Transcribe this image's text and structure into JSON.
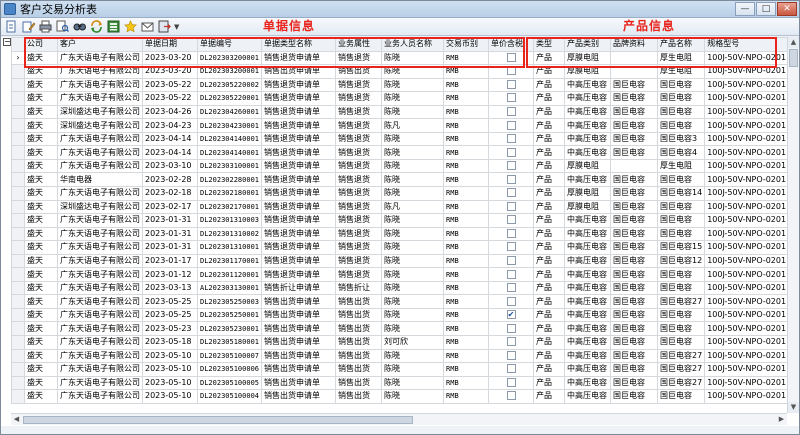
{
  "window": {
    "title": "客户交易分析表",
    "buttons": {
      "minimize": "—",
      "maximize": "□",
      "close": "✕"
    }
  },
  "toolbar": {
    "icons": [
      "new-doc-icon",
      "edit-doc-icon",
      "print-icon",
      "print-preview-icon",
      "find-icon",
      "refresh-icon",
      "export-excel-icon",
      "favorite-icon",
      "mail-icon",
      "exit-icon"
    ]
  },
  "annotations": {
    "group_left": "单据信息",
    "group_right": "产品信息",
    "highlight_color": "#e8241c"
  },
  "grid": {
    "columns": [
      "公司",
      "客户",
      "单据日期",
      "单据编号",
      "单据类型名称",
      "业务属性",
      "业务人员名称",
      "交易币别",
      "单价含税",
      "类型",
      "产品类别",
      "品牌资料",
      "产品名称",
      "规格型号"
    ],
    "rows": [
      [
        "盛天",
        "广东天语电子有限公司",
        "2023-03-20",
        "DL202303200001",
        "销售退货申请单",
        "销售退货",
        "陈晓",
        "RMB",
        false,
        "产品",
        "厚膜电阻",
        "",
        "厚生电阻",
        "100J-50V-NPO-0201"
      ],
      [
        "盛天",
        "广东天语电子有限公司",
        "2023-03-20",
        "DL202303200001",
        "销售出货申请单",
        "销售出货",
        "陈晓",
        "RMB",
        false,
        "产品",
        "厚膜电阻",
        "",
        "厚生电阻",
        "100J-50V-NPO-0201"
      ],
      [
        "盛天",
        "广东天语电子有限公司",
        "2023-05-22",
        "DL202305220002",
        "销售退货申请单",
        "销售退货",
        "陈晓",
        "RMB",
        false,
        "产品",
        "中高压电容",
        "国巨电容",
        "国巨电容",
        "100J-50V-NPO-0201"
      ],
      [
        "盛天",
        "广东天语电子有限公司",
        "2023-05-22",
        "DL202305220001",
        "销售退货申请单",
        "销售退货",
        "陈晓",
        "RMB",
        false,
        "产品",
        "中高压电容",
        "国巨电容",
        "国巨电容",
        "100J-50V-NPO-0201"
      ],
      [
        "盛天",
        "深圳盛达电子有限公司",
        "2023-04-26",
        "DL202304260001",
        "销售退货申请单",
        "销售退货",
        "陈晓",
        "RMB",
        false,
        "产品",
        "中高压电容",
        "国巨电容",
        "国巨电容",
        "100J-50V-NPO-0201"
      ],
      [
        "盛天",
        "深圳盛达电子有限公司",
        "2023-04-23",
        "DL202304230001",
        "销售退货申请单",
        "销售退货",
        "陈凡",
        "RMB",
        false,
        "产品",
        "中高压电容",
        "国巨电容",
        "国巨电容",
        "100J-50V-NPO-0201"
      ],
      [
        "盛天",
        "广东天语电子有限公司",
        "2023-04-14",
        "DL202304140001",
        "销售退货申请单",
        "销售退货",
        "陈晓",
        "RMB",
        false,
        "产品",
        "中高压电容",
        "国巨电容",
        "国巨电容3",
        "100J-50V-NPO-0201"
      ],
      [
        "盛天",
        "广东天语电子有限公司",
        "2023-04-14",
        "DL202304140001",
        "销售退货申请单",
        "销售退货",
        "陈晓",
        "RMB",
        false,
        "产品",
        "中高压电容",
        "国巨电容",
        "国巨电容4",
        "100J-50V-NPO-0201"
      ],
      [
        "盛天",
        "广东天语电子有限公司",
        "2023-03-10",
        "DL202303100001",
        "销售退货申请单",
        "销售退货",
        "陈晓",
        "RMB",
        false,
        "产品",
        "厚膜电阻",
        "",
        "厚生电阻",
        "100J-50V-NPO-0201"
      ],
      [
        "盛天",
        "华南电器",
        "2023-02-28",
        "DL202302280001",
        "销售退货申请单",
        "销售退货",
        "陈晓",
        "RMB",
        false,
        "产品",
        "中高压电容",
        "国巨电容",
        "国巨电容",
        "100J-50V-NPO-0201"
      ],
      [
        "盛天",
        "广东天语电子有限公司",
        "2023-02-18",
        "DL202302180001",
        "销售退货申请单",
        "销售退货",
        "陈晓",
        "RMB",
        false,
        "产品",
        "厚膜电阻",
        "国巨电容",
        "国巨电容14",
        "100J-50V-NPO-0201"
      ],
      [
        "盛天",
        "深圳盛达电子有限公司",
        "2023-02-17",
        "DL202302170001",
        "销售退货申请单",
        "销售退货",
        "陈凡",
        "RMB",
        false,
        "产品",
        "厚膜电阻",
        "国巨电容",
        "国巨电容",
        "100J-50V-NPO-0201"
      ],
      [
        "盛天",
        "广东天语电子有限公司",
        "2023-01-31",
        "DL202301310003",
        "销售退货申请单",
        "销售退货",
        "陈晓",
        "RMB",
        false,
        "产品",
        "中高压电容",
        "国巨电容",
        "国巨电容",
        "100J-50V-NPO-0201"
      ],
      [
        "盛天",
        "广东天语电子有限公司",
        "2023-01-31",
        "DL202301310002",
        "销售退货申请单",
        "销售退货",
        "陈晓",
        "RMB",
        false,
        "产品",
        "中高压电容",
        "国巨电容",
        "国巨电容",
        "100J-50V-NPO-0201"
      ],
      [
        "盛天",
        "广东天语电子有限公司",
        "2023-01-31",
        "DL202301310001",
        "销售退货申请单",
        "销售退货",
        "陈晓",
        "RMB",
        false,
        "产品",
        "中高压电容",
        "国巨电容",
        "国巨电容15",
        "100J-50V-NPO-0201"
      ],
      [
        "盛天",
        "广东天语电子有限公司",
        "2023-01-17",
        "DL202301170001",
        "销售退货申请单",
        "销售退货",
        "陈晓",
        "RMB",
        false,
        "产品",
        "中高压电容",
        "国巨电容",
        "国巨电容12",
        "100J-50V-NPO-0201"
      ],
      [
        "盛天",
        "广东天语电子有限公司",
        "2023-01-12",
        "DL202301120001",
        "销售退货申请单",
        "销售退货",
        "陈晓",
        "RMB",
        false,
        "产品",
        "中高压电容",
        "国巨电容",
        "国巨电容",
        "100J-50V-NPO-0201"
      ],
      [
        "盛天",
        "广东天语电子有限公司",
        "2023-03-13",
        "AL202303130001",
        "销售折让申请单",
        "销售折让",
        "陈晓",
        "RMB",
        false,
        "产品",
        "中高压电容",
        "国巨电容",
        "国巨电容",
        "100J-50V-NPO-0201"
      ],
      [
        "盛天",
        "广东天语电子有限公司",
        "2023-05-25",
        "DL202305250003",
        "销售出货申请单",
        "销售出货",
        "陈晓",
        "RMB",
        false,
        "产品",
        "中高压电容",
        "国巨电容",
        "国巨电容27",
        "100J-50V-NPO-0201"
      ],
      [
        "盛天",
        "广东天语电子有限公司",
        "2023-05-25",
        "DL202305250001",
        "销售出货申请单",
        "销售出货",
        "陈晓",
        "RMB",
        true,
        "产品",
        "中高压电容",
        "国巨电容",
        "国巨电容",
        "100J-50V-NPO-0201"
      ],
      [
        "盛天",
        "广东天语电子有限公司",
        "2023-05-23",
        "DL202305230001",
        "销售出货申请单",
        "销售出货",
        "陈晓",
        "RMB",
        false,
        "产品",
        "中高压电容",
        "国巨电容",
        "国巨电容",
        "100J-50V-NPO-0201"
      ],
      [
        "盛天",
        "广东天语电子有限公司",
        "2023-05-18",
        "DL202305180001",
        "销售出货申请单",
        "销售出货",
        "刘可欣",
        "RMB",
        false,
        "产品",
        "中高压电容",
        "国巨电容",
        "国巨电容",
        "100J-50V-NPO-0201"
      ],
      [
        "盛天",
        "广东天语电子有限公司",
        "2023-05-10",
        "DL202305100007",
        "销售出货申请单",
        "销售出货",
        "陈晓",
        "RMB",
        false,
        "产品",
        "中高压电容",
        "国巨电容",
        "国巨电容27",
        "100J-50V-NPO-0201"
      ],
      [
        "盛天",
        "广东天语电子有限公司",
        "2023-05-10",
        "DL202305100006",
        "销售出货申请单",
        "销售出货",
        "陈晓",
        "RMB",
        false,
        "产品",
        "中高压电容",
        "国巨电容",
        "国巨电容27",
        "100J-50V-NPO-0201"
      ],
      [
        "盛天",
        "广东天语电子有限公司",
        "2023-05-10",
        "DL202305100005",
        "销售出货申请单",
        "销售出货",
        "陈晓",
        "RMB",
        false,
        "产品",
        "中高压电容",
        "国巨电容",
        "国巨电容27",
        "100J-50V-NPO-0201"
      ],
      [
        "盛天",
        "广东天语电子有限公司",
        "2023-05-10",
        "DL202305100004",
        "销售出货申请单",
        "销售出货",
        "陈晓",
        "RMB",
        false,
        "产品",
        "中高压电容",
        "国巨电容",
        "国巨电容",
        "100J-50V-NPO-0201"
      ]
    ]
  }
}
